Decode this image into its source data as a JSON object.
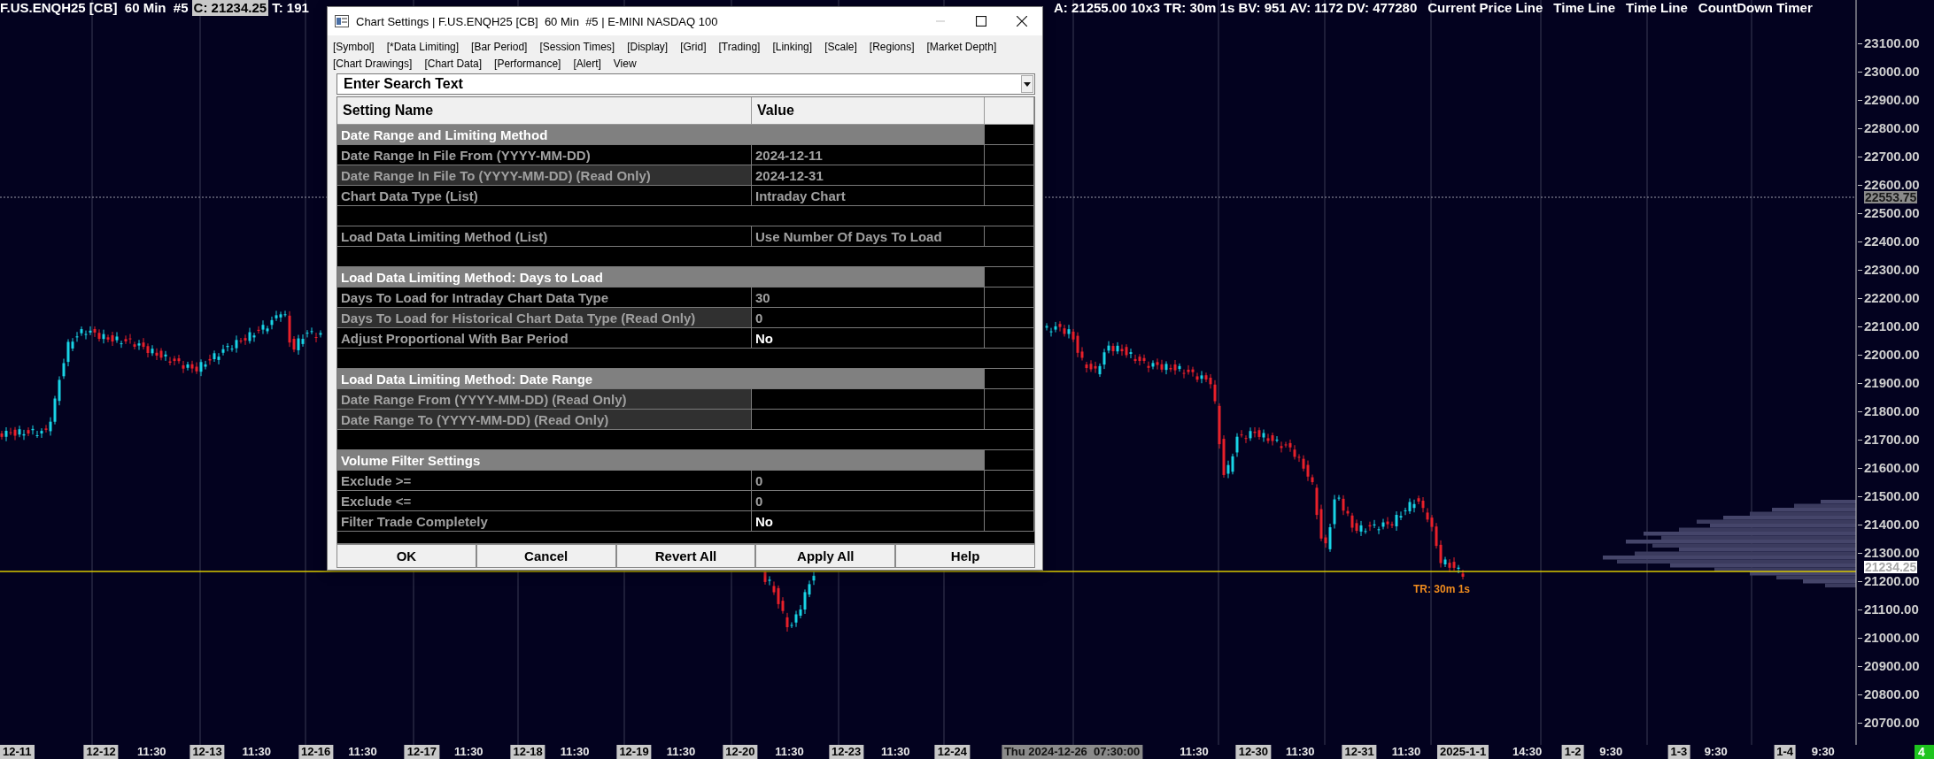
{
  "chart_header": {
    "symbol": "F.US.ENQH25 [CB]  60 Min  #5",
    "close": "C: 21234.25",
    "trade": "T: 191",
    "stats": "A: 21255.00 10x3 TR: 30m 1s BV: 951 AV: 1172 DV: 477280",
    "studies": [
      "Current Price Line",
      "Time Line",
      "Time Line",
      "CountDown Timer"
    ]
  },
  "price_axis": {
    "labels": [
      "23100.00",
      "23000.00",
      "22900.00",
      "22800.00",
      "22700.00",
      "22600.00",
      "22500.00",
      "22400.00",
      "22300.00",
      "22200.00",
      "22100.00",
      "22000.00",
      "21900.00",
      "21800.00",
      "21700.00",
      "21600.00",
      "21500.00",
      "21400.00",
      "21300.00",
      "21200.00",
      "21100.00",
      "21000.00",
      "20900.00",
      "20800.00",
      "20700.00"
    ],
    "cursor_price": "22553.75",
    "current_price": "21234.25"
  },
  "countdown_label": "TR: 30m 1s",
  "time_axis": [
    {
      "label": "12-11",
      "kind": "date"
    },
    {
      "label": "12-12",
      "kind": "date"
    },
    {
      "label": "11:30",
      "kind": "time"
    },
    {
      "label": "12-13",
      "kind": "date"
    },
    {
      "label": "11:30",
      "kind": "time"
    },
    {
      "label": "12-16",
      "kind": "date"
    },
    {
      "label": "11:30",
      "kind": "time"
    },
    {
      "label": "12-17",
      "kind": "date"
    },
    {
      "label": "11:30",
      "kind": "time"
    },
    {
      "label": "12-18",
      "kind": "date"
    },
    {
      "label": "11:30",
      "kind": "time"
    },
    {
      "label": "12-19",
      "kind": "date"
    },
    {
      "label": "11:30",
      "kind": "time"
    },
    {
      "label": "12-20",
      "kind": "date"
    },
    {
      "label": "11:30",
      "kind": "time"
    },
    {
      "label": "12-23",
      "kind": "date"
    },
    {
      "label": "11:30",
      "kind": "time"
    },
    {
      "label": "12-24",
      "kind": "date"
    },
    {
      "label": "Thu 2024-12-26  07:30:00",
      "kind": "cursor"
    },
    {
      "label": "11:30",
      "kind": "time"
    },
    {
      "label": "12-30",
      "kind": "date"
    },
    {
      "label": "11:30",
      "kind": "time"
    },
    {
      "label": "12-31",
      "kind": "date"
    },
    {
      "label": "11:30",
      "kind": "time"
    },
    {
      "label": "2025-1-1",
      "kind": "date"
    },
    {
      "label": "14:30",
      "kind": "time"
    },
    {
      "label": "1-2",
      "kind": "date"
    },
    {
      "label": "9:30",
      "kind": "time"
    },
    {
      "label": "1-3",
      "kind": "date"
    },
    {
      "label": "9:30",
      "kind": "time"
    },
    {
      "label": "1-4",
      "kind": "date"
    },
    {
      "label": "9:30",
      "kind": "time"
    }
  ],
  "corner_badge": "4",
  "dialog": {
    "title": "Chart Settings | F.US.ENQH25 [CB]  60 Min  #5 | E-MINI NASDAQ 100",
    "menu_rows": [
      [
        "[Symbol]",
        "[*Data Limiting]",
        "[Bar Period]",
        "[Session Times]",
        "[Display]",
        "[Grid]",
        "[Trading]",
        "[Linking]",
        "[Scale]",
        "[Regions]",
        "[Market Depth]"
      ],
      [
        "[Chart Drawings]",
        "[Chart Data]",
        "[Performance]",
        "[Alert]",
        "View"
      ]
    ],
    "search": {
      "value": "Enter Search Text"
    },
    "columns": [
      "Setting Name",
      "Value"
    ],
    "rows": [
      {
        "kind": "section",
        "name": "Date Range and Limiting Method"
      },
      {
        "kind": "setting",
        "name": "Date Range In File From (YYYY-MM-DD)",
        "value": "2024-12-11",
        "read_only": false,
        "bright_value": false
      },
      {
        "kind": "setting",
        "name": "Date Range In File To (YYYY-MM-DD) (Read Only)",
        "value": "2024-12-31",
        "read_only": true,
        "bright_value": false
      },
      {
        "kind": "setting",
        "name": "Chart Data Type (List)",
        "value": "Intraday Chart",
        "read_only": false,
        "bright_value": false
      },
      {
        "kind": "blank"
      },
      {
        "kind": "setting",
        "name": "Load Data Limiting Method (List)",
        "value": "Use Number Of Days To Load",
        "read_only": false,
        "bright_value": false
      },
      {
        "kind": "blank"
      },
      {
        "kind": "section",
        "name": "Load Data Limiting Method: Days to Load"
      },
      {
        "kind": "setting",
        "name": "Days To Load for Intraday Chart Data Type",
        "value": "30",
        "read_only": false,
        "bright_value": false
      },
      {
        "kind": "setting",
        "name": "Days To Load for Historical Chart Data Type (Read Only)",
        "value": "0",
        "read_only": true,
        "bright_value": false
      },
      {
        "kind": "setting",
        "name": "Adjust Proportional With Bar Period",
        "value": "No",
        "read_only": false,
        "bright_value": true
      },
      {
        "kind": "blank"
      },
      {
        "kind": "section",
        "name": "Load Data Limiting Method: Date Range"
      },
      {
        "kind": "setting",
        "name": "Date Range From (YYYY-MM-DD) (Read Only)",
        "read_only": true
      },
      {
        "kind": "setting",
        "name": "Date Range To (YYYY-MM-DD) (Read Only)",
        "read_only": true
      },
      {
        "kind": "blank"
      },
      {
        "kind": "section",
        "name": "Volume Filter Settings"
      },
      {
        "kind": "setting",
        "name": "Exclude >=",
        "value": "0",
        "read_only": false,
        "bright_value": false
      },
      {
        "kind": "setting",
        "name": "Exclude <=",
        "value": "0",
        "read_only": false,
        "bright_value": false
      },
      {
        "kind": "setting",
        "name": "Filter Trade Completely",
        "value": "No",
        "read_only": false,
        "bright_value": true
      }
    ],
    "buttons": [
      "OK",
      "Cancel",
      "Revert All",
      "Apply All",
      "Help"
    ]
  }
}
